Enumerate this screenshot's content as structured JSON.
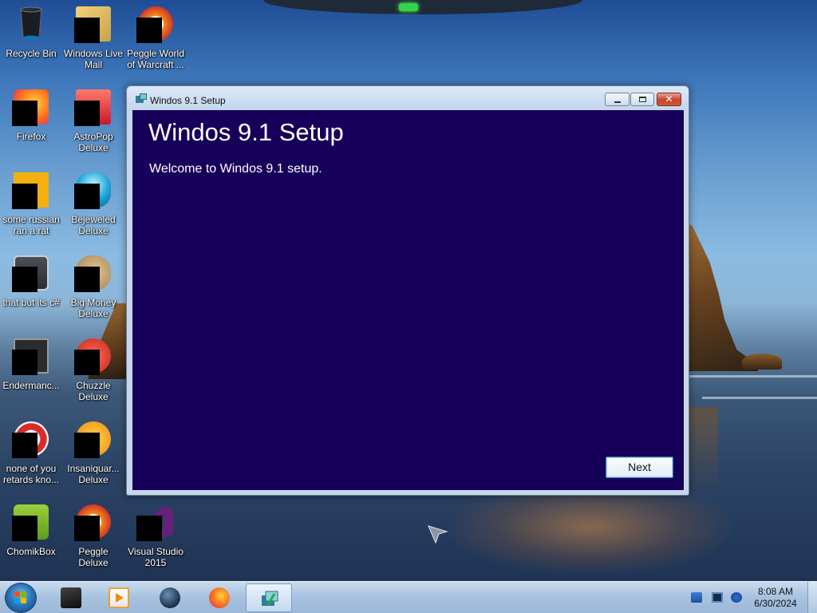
{
  "desktop": {
    "icons": [
      {
        "label": "Recycle Bin",
        "icon": "recycle-bin-icon"
      },
      {
        "label": "Windows Live\nMail",
        "icon": "windows-live-mail-icon"
      },
      {
        "label": "Peggle World\nof Warcraft ...",
        "icon": "peggle-world-of-warcraft-icon"
      },
      {
        "label": "Firefox",
        "icon": "firefox-icon"
      },
      {
        "label": "AstroPop\nDeluxe",
        "icon": "astropop-deluxe-icon"
      },
      {
        "label": "some russian\nran a rat",
        "icon": "some-russian-ran-a-rat-icon"
      },
      {
        "label": "Bejeweled\nDeluxe",
        "icon": "bejeweled-deluxe-icon"
      },
      {
        "label": "that but its c#",
        "icon": "that-but-its-csharp-icon"
      },
      {
        "label": "Big Money\nDeluxe",
        "icon": "big-money-deluxe-icon"
      },
      {
        "label": "Endermanc...",
        "icon": "endermanch-icon"
      },
      {
        "label": "Chuzzle\nDeluxe",
        "icon": "chuzzle-deluxe-icon"
      },
      {
        "label": "none of you\nretards kno...",
        "icon": "none-of-you-icon"
      },
      {
        "label": "Insaniquar...\nDeluxe",
        "icon": "insaniquarium-deluxe-icon"
      },
      {
        "label": "ChomikBox",
        "icon": "chomikbox-icon"
      },
      {
        "label": "Peggle Deluxe",
        "icon": "peggle-deluxe-icon"
      },
      {
        "label": "Visual Studio\n2015",
        "icon": "visual-studio-2015-icon"
      }
    ]
  },
  "window": {
    "title": "Windos 9.1 Setup",
    "heading": "Windos 9.1 Setup",
    "welcome": "Welcome to Windos 9.1 setup.",
    "next_label": "Next",
    "client_color": "#17005a"
  },
  "taskbar": {
    "time": "8:08 AM",
    "date": "6/30/2024",
    "pinned": [
      "media-player-icon",
      "firefox-icon",
      "setup-icon"
    ],
    "tray": [
      "network-icon",
      "display-icon",
      "volume-icon"
    ]
  }
}
